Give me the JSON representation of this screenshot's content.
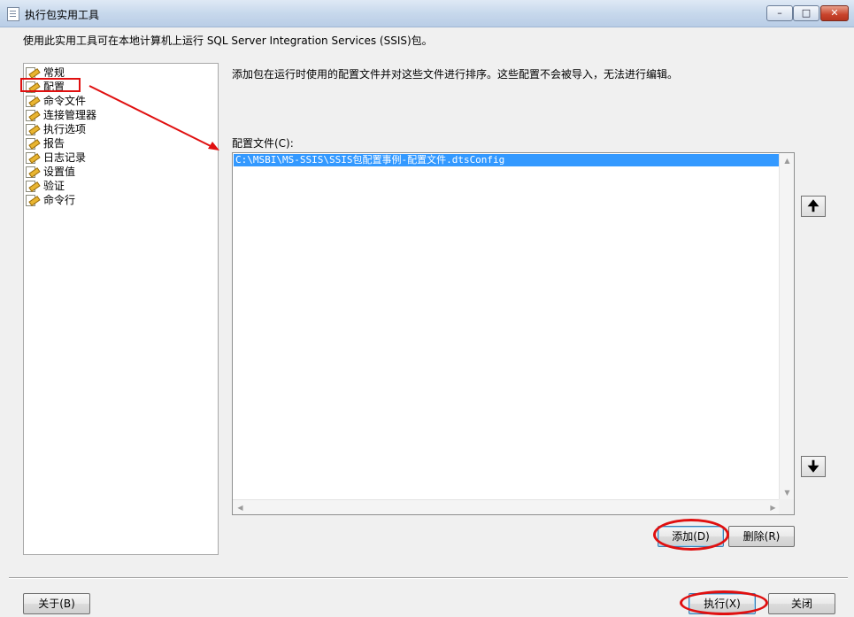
{
  "window": {
    "title": "执行包实用工具",
    "controls": {
      "minimize": "–",
      "maximize": "□",
      "close": "✕"
    }
  },
  "description": "使用此实用工具可在本地计算机上运行 SQL Server Integration Services (SSIS)包。",
  "sidebar": {
    "items": [
      {
        "label": "常规",
        "icon": "page-edit-icon"
      },
      {
        "label": "配置",
        "icon": "page-edit-icon"
      },
      {
        "label": "命令文件",
        "icon": "page-edit-icon"
      },
      {
        "label": "连接管理器",
        "icon": "page-edit-icon"
      },
      {
        "label": "执行选项",
        "icon": "page-edit-icon"
      },
      {
        "label": "报告",
        "icon": "page-edit-icon"
      },
      {
        "label": "日志记录",
        "icon": "page-edit-icon"
      },
      {
        "label": "设置值",
        "icon": "page-edit-icon"
      },
      {
        "label": "验证",
        "icon": "page-edit-icon"
      },
      {
        "label": "命令行",
        "icon": "page-edit-icon"
      }
    ]
  },
  "main": {
    "description": "添加包在运行时使用的配置文件并对这些文件进行排序。这些配置不会被导入，无法进行编辑。",
    "list_label": "配置文件(C):",
    "config_files": [
      "C:\\MSBI\\MS-SSIS\\SSIS包配置事例-配置文件.dtsConfig"
    ],
    "move_up": "🠉",
    "move_down": "🠋",
    "add_label": "添加(D)",
    "remove_label": "删除(R)"
  },
  "footer": {
    "about_label": "关于(B)",
    "execute_label": "执行(X)",
    "close_label": "关闭"
  },
  "colors": {
    "annotation": "#e01010",
    "selection": "#3399ff"
  }
}
